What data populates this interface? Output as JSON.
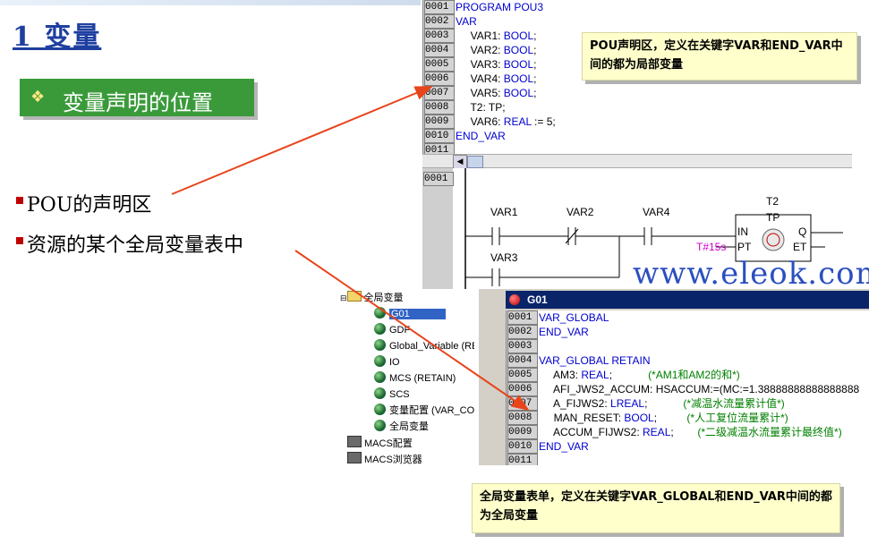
{
  "slide": {
    "title": "1 变量",
    "banner": "变量声明的位置",
    "banner_icon": "diamond-bullet-icon",
    "bullets": [
      "POU的声明区",
      "资源的某个全局变量表中"
    ]
  },
  "pou_editor": {
    "lines": [
      {
        "num": "0001",
        "parts": [
          {
            "t": "PROGRAM POU3",
            "c": "kw"
          }
        ]
      },
      {
        "num": "0002",
        "parts": [
          {
            "t": "VAR",
            "c": "kw"
          }
        ]
      },
      {
        "num": "0003",
        "parts": [
          {
            "t": "     VAR1: ",
            "c": ""
          },
          {
            "t": "BOOL",
            "c": "kw"
          },
          {
            "t": ";",
            "c": ""
          }
        ]
      },
      {
        "num": "0004",
        "parts": [
          {
            "t": "     VAR2: ",
            "c": ""
          },
          {
            "t": "BOOL",
            "c": "kw"
          },
          {
            "t": ";",
            "c": ""
          }
        ]
      },
      {
        "num": "0005",
        "parts": [
          {
            "t": "     VAR3: ",
            "c": ""
          },
          {
            "t": "BOOL",
            "c": "kw"
          },
          {
            "t": ";",
            "c": ""
          }
        ]
      },
      {
        "num": "0006",
        "parts": [
          {
            "t": "     VAR4: ",
            "c": ""
          },
          {
            "t": "BOOL",
            "c": "kw"
          },
          {
            "t": ";",
            "c": ""
          }
        ]
      },
      {
        "num": "0007",
        "parts": [
          {
            "t": "     VAR5: ",
            "c": ""
          },
          {
            "t": "BOOL",
            "c": "kw"
          },
          {
            "t": ";",
            "c": ""
          }
        ]
      },
      {
        "num": "0008",
        "parts": [
          {
            "t": "     T2: TP;",
            "c": ""
          }
        ]
      },
      {
        "num": "0009",
        "parts": [
          {
            "t": "     VAR6: ",
            "c": ""
          },
          {
            "t": "REAL",
            "c": "kw"
          },
          {
            "t": " := 5;",
            "c": ""
          }
        ]
      },
      {
        "num": "0010",
        "parts": [
          {
            "t": "END_VAR",
            "c": "kw"
          }
        ]
      },
      {
        "num": "0011",
        "parts": []
      }
    ]
  },
  "ladder": {
    "line_num": "0001",
    "contacts": [
      "VAR1",
      "VAR2",
      "VAR4",
      "VAR3"
    ],
    "timer_name": "T2",
    "timer_type": "TP",
    "pin_in": "IN",
    "pin_pt": "PT",
    "pin_q": "Q",
    "pin_et": "ET",
    "pt_value": "T#15s"
  },
  "callouts": {
    "pou": "POU声明区，定义在关键字VAR和END_VAR中间的都为局部变量",
    "global": "全局变量表单，定义在关键字VAR_GLOBAL和END_VAR中间的都为全局变量"
  },
  "tree": {
    "root": "全局变量",
    "items": [
      "G01",
      "GDF",
      "Global_Variable (RE",
      "IO",
      "MCS (RETAIN)",
      "SCS",
      "变量配置 (VAR_CO",
      "全局变量"
    ],
    "selected_index": 0,
    "extra": [
      "MACS配置",
      "MACS浏览器"
    ]
  },
  "g01_editor": {
    "title": "G01",
    "lines": [
      {
        "num": "0001",
        "parts": [
          {
            "t": "VAR_GLOBAL",
            "c": "kw"
          }
        ]
      },
      {
        "num": "0002",
        "parts": [
          {
            "t": "END_VAR",
            "c": "kw"
          }
        ]
      },
      {
        "num": "0003",
        "parts": []
      },
      {
        "num": "0004",
        "parts": [
          {
            "t": "VAR_GLOBAL RETAIN",
            "c": "kw"
          }
        ]
      },
      {
        "num": "0005",
        "parts": [
          {
            "t": "     AM3: ",
            "c": ""
          },
          {
            "t": "REAL",
            "c": "kw"
          },
          {
            "t": ";            ",
            "c": ""
          },
          {
            "t": "(*AM1和AM2的和*)",
            "c": "cm"
          }
        ]
      },
      {
        "num": "0006",
        "parts": [
          {
            "t": "     AFI_JWS2_ACCUM: HSACCUM:=(MC:=1.38888888888888888",
            "c": ""
          }
        ]
      },
      {
        "num": "0007",
        "parts": [
          {
            "t": "     A_FIJWS2: ",
            "c": ""
          },
          {
            "t": "LREAL",
            "c": "kw"
          },
          {
            "t": ";            ",
            "c": ""
          },
          {
            "t": "(*减温水流量累计值*)",
            "c": "cm"
          }
        ]
      },
      {
        "num": "0008",
        "parts": [
          {
            "t": "     MAN_RESET: ",
            "c": ""
          },
          {
            "t": "BOOL",
            "c": "kw"
          },
          {
            "t": ";          ",
            "c": ""
          },
          {
            "t": "(*人工复位流量累计*)",
            "c": "cm"
          }
        ]
      },
      {
        "num": "0009",
        "parts": [
          {
            "t": "     ACCUM_FIJWS2: ",
            "c": ""
          },
          {
            "t": "REAL",
            "c": "kw"
          },
          {
            "t": ";        ",
            "c": ""
          },
          {
            "t": "(*二级减温水流量累计最终值*)",
            "c": "cm"
          }
        ]
      },
      {
        "num": "0010",
        "parts": [
          {
            "t": "END_VAR",
            "c": "kw"
          }
        ]
      },
      {
        "num": "0011",
        "parts": []
      }
    ]
  },
  "watermark": "www.eleok.com",
  "colors": {
    "title": "#1f3fa0",
    "banner": "#3a9a3a",
    "keyword": "#0000d0",
    "comment": "#008000",
    "arrow": "#e8451c",
    "callout": "#ffffcc"
  }
}
